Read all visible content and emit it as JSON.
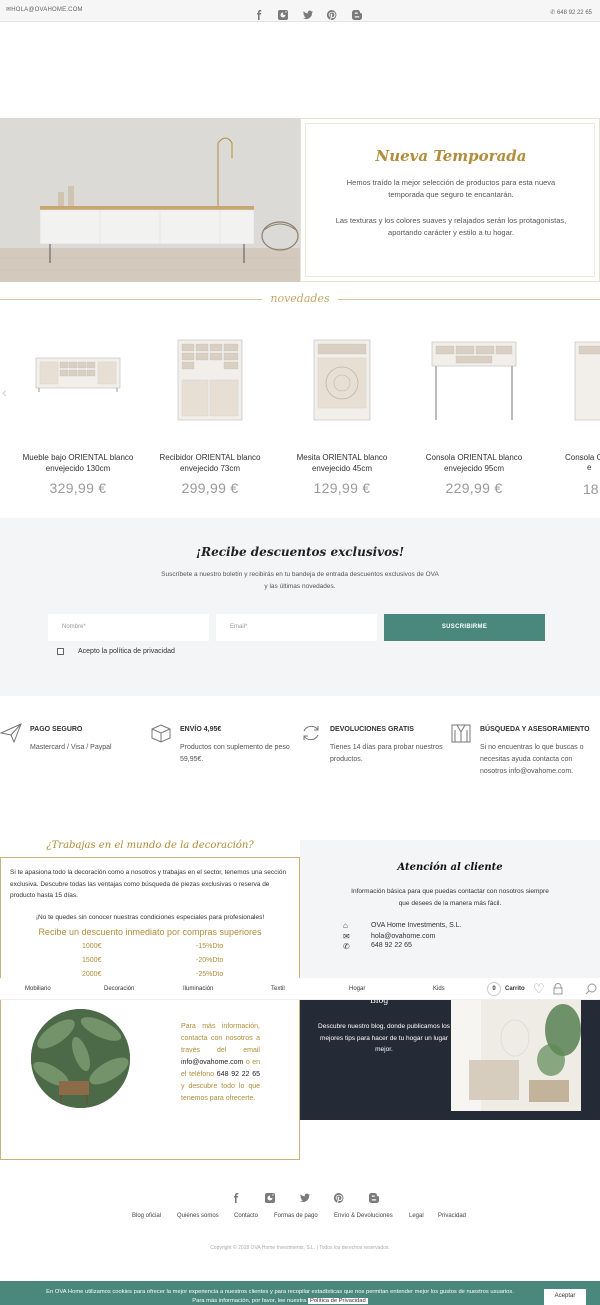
{
  "topbar": {
    "email": "HOLA@OVAHOME.COM",
    "phone": "648 92 22 65",
    "social_icons": [
      "facebook-icon",
      "instagram-icon",
      "twitter-icon",
      "pinterest-icon",
      "blogger-icon"
    ]
  },
  "hero": {
    "title": "Nueva Temporada",
    "text1": "Hemos traído la mejor selección de productos para esta nueva temporada que seguro te encantarán.",
    "text2": "Las texturas y los colores suaves y relajados serán los protagonistas, aportando carácter y estilo a tu hogar."
  },
  "novedades": {
    "label": "novedades",
    "products": [
      {
        "name": "Mueble bajo ORIENTAL blanco envejecido 130cm",
        "price": "329,99 €"
      },
      {
        "name": "Recibidor ORIENTAL blanco envejecido 73cm",
        "price": "299,99 €"
      },
      {
        "name": "Mesita ORIENTAL blanco envejecido 45cm",
        "price": "129,99 €"
      },
      {
        "name": "Consola ORIENTAL blanco envejecido 95cm",
        "price": "229,99 €"
      },
      {
        "name": "Consola O",
        "name2": "e",
        "price": "18"
      }
    ]
  },
  "newsletter": {
    "title": "¡Recibe descuentos exclusivos!",
    "text": "Suscríbete a nuestro boletín y recibirás en tu bandeja de entrada descuentos exclusivos de OVA y las últimas novedades.",
    "name_placeholder": "Nombre*",
    "email_placeholder": "Email*",
    "button": "SUSCRIBIRME",
    "privacy": "Acepto la política de privacidad"
  },
  "features": [
    {
      "title": "PAGO SEGURO",
      "desc": "Mastercard / Visa / Paypal",
      "icon": "paper-plane-icon"
    },
    {
      "title": "ENVÍO 4,95€",
      "desc": "Productos con suplemento de peso 59,95€.",
      "icon": "box-icon"
    },
    {
      "title": "DEVOLUCIONES GRATIS",
      "desc": "Tienes 14 días para probar nuestros productos.",
      "icon": "refresh-icon"
    },
    {
      "title": "BÚSQUEDA Y ASESORAMIENTO",
      "desc": "Si no encuentras lo que buscas o necesitas ayuda contacta con nosotros info@ovahome.com.",
      "icon": "coat-icon"
    }
  ],
  "pro": {
    "title": "¿Trabajas en el mundo de la decoración?",
    "text": "Si te apasiona todo la decoración como a nosotros y trabajas en el sector, tenemos una sección exclusiva. Descubre todas las ventajas como búsqueda de piezas exclusivas o reserva de producto hasta 15 días.",
    "note": "¡No te quedes sin conocer nuestras condiciones especiales para profesionales!",
    "discount_title": "Recibe un descuento inmediato por compras superiores",
    "tiers": [
      {
        "amount": "1000€",
        "discount": "-15%Dto"
      },
      {
        "amount": "1500€",
        "discount": "-20%Dto"
      },
      {
        "amount": "2000€",
        "discount": "-25%Dto"
      }
    ],
    "contact": [
      "Para más información, contacta con nosotros a través del email",
      "info@ovahome.com",
      "o en el teléfono",
      "648 92 22 65",
      "y descubre todo lo que tenemos para ofrecerte."
    ]
  },
  "attention": {
    "title": "Atención al cliente",
    "text": "Información básica para que puedas contactar con nosotros siempre que desees de la manera más fácil.",
    "company": "OVA Home Investments, S.L.",
    "email": "hola@ovahome.com",
    "phone": "648 92 22 65"
  },
  "nav": {
    "items": [
      "Mobiliario",
      "Decoración",
      "Iluminación",
      "Textil",
      "Hogar",
      "Kids"
    ],
    "cart_count": "0",
    "cart_label": "Carrito"
  },
  "blog": {
    "title": "Blog",
    "text": "Descubre nuestro blog, donde publicamos los mejores tips para hacer de tu hogar un lugar mejor."
  },
  "footer": {
    "links": [
      "Blog oficial",
      "Quiénes somos",
      "Contacto",
      "Formas de pago",
      "Envío & Devoluciones",
      "Legal",
      "Privacidad"
    ],
    "copyright": "Copyright © 2018 OVA Home Investments, S.L. | Todos los derechos reservados."
  },
  "cookie": {
    "text": "En OVA Home utilizamos cookies para ofrecer la mejor experiencia a nuestros clientes y para recopilar estadísticas que nos permitan entender mejor los gustos de nuestros usuarios.",
    "text2": "Para más información, por favor, lee nuestra",
    "link": "Política de Privacidad",
    "accept": "Aceptar"
  },
  "colors": {
    "accent": "#4a877c",
    "gold": "#b08d3a",
    "dark": "#252b36"
  }
}
